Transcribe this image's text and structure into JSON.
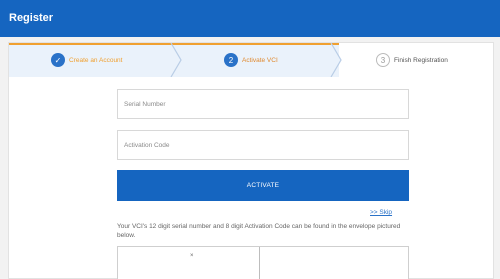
{
  "window": {
    "title": "Register"
  },
  "stepper": {
    "steps": [
      {
        "number": "",
        "label": "Create an Account",
        "status": "completed"
      },
      {
        "number": "2",
        "label": "Activate VCI",
        "status": "current"
      },
      {
        "number": "3",
        "label": "Finish Registration",
        "status": "pending"
      }
    ],
    "check_glyph": "✓"
  },
  "form": {
    "serial_placeholder": "Serial Number",
    "activation_placeholder": "Activation Code",
    "activate_label": "ACTIVATE",
    "skip_label": ">> Skip",
    "info_text": "Your VCI's 12 digit serial number and 8 digit Activation Code can be found in the envelope pictured below.",
    "image_mark": "×"
  },
  "colors": {
    "primary": "#1565c0",
    "accent": "#f0a030",
    "step_bg": "#eaf2fb"
  }
}
